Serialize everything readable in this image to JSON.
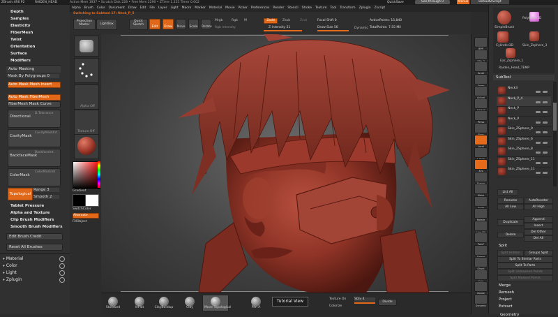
{
  "titlebar": {
    "app": "ZBrush 4R6 P2",
    "doc": "RAIDEN_HEAD",
    "stats": "Active Mem 1937 • Scratch Disk 228 • Free Mem 2290 • ZTime 1.255 Timer 0.002",
    "quicksave": "QuickSave",
    "seethrough": "See-through 0",
    "menus": "Menus",
    "script": "DefaultZScript"
  },
  "menubar": [
    "Alpha",
    "Brush",
    "Color",
    "Document",
    "Draw",
    "Edit",
    "File",
    "Layer",
    "Light",
    "Macro",
    "Marker",
    "Material",
    "Movie",
    "Picker",
    "Preferences",
    "Render",
    "Stencil",
    "Stroke",
    "Texture",
    "Tool",
    "Transform",
    "Zplugin",
    "Zscript"
  ],
  "switching": "Switching to Subtool 17: Neck_P_5",
  "shelf": {
    "projection_master": "Projection Master",
    "lightbox": "LightBox",
    "quick_sketch": "Quick Sketch",
    "edit": "Edit",
    "draw": "Draw",
    "move": "Move",
    "scale": "Scale",
    "rotate": "Rotate",
    "mrgb": "Mrgb",
    "rgb": "Rgb",
    "m": "M",
    "rgb_intensity": "Rgb Intensity",
    "zadd": "Zadd",
    "zsub": "Zsub",
    "zcut": "Zcut",
    "z_intensity": "Z Intensity 51",
    "focal_shift": "Focal Shift 0",
    "draw_size": "Draw Size 56",
    "dynamic": "Dynamic",
    "active_points": "ActivePoints: 15,840",
    "total_points": "TotalPoints: 7.55 Mil"
  },
  "left_tray": {
    "headers": [
      "Depth",
      "Samples",
      "Elasticity",
      "FiberMesh",
      "Twist",
      "Orientation",
      "Surface",
      "Modifiers"
    ],
    "auto_masking": "Auto Masking",
    "mask_by_polygroups": "Mask By Polygroups 0",
    "auto_mask_mesh_insert": "Auto Mask Mesh Insert",
    "auto_mask_fibermesh": "Auto Mask FiberMesh",
    "fibermesh_mask_curve": "FiberMesh Mask Curve",
    "directional": "Directional",
    "directional_val": "D.Tolerance",
    "cavity_mask": "CavityMask",
    "cavity_val": "CavityMaskInt",
    "backface_mask": "BackfaceMask",
    "backface_val": "BackfaceInt",
    "color_mask": "ColorMask",
    "color_val": "ColorMaskInt",
    "topological": "Topological",
    "range": "Range 3",
    "smooth": "Smooth 2",
    "sections": [
      "Tablet Pressure",
      "Alpha and Texture",
      "Clip Brush Modifiers",
      "Smooth Brush Modifiers"
    ],
    "edit_brush_credit": "Edit Brush Credit",
    "reset_all_brushes": "Reset All Brushes",
    "palettes": [
      "Material",
      "Color",
      "Light",
      "Zplugin"
    ]
  },
  "brush_col": {
    "alpha_off": "Alpha Off",
    "texture_off": "Texture Off",
    "gradient": "Gradient",
    "switch_color": "SwitchColor",
    "alternate": "Alternate",
    "fillobject": "FillObject"
  },
  "right_shelf": [
    "BPR",
    "SPix 3",
    "Scroll",
    "Zoom",
    "Actual",
    "AAHalf",
    "Persp",
    "Floor",
    "Local",
    "L.Sym",
    "Xyz",
    "Frame",
    "Move",
    "Scale",
    "Rotate",
    "Line Fill",
    "PolyF",
    "Transp",
    "Ghost",
    "Solo",
    "Xpose",
    "Dynamic"
  ],
  "right_tray": {
    "tools": [
      "SimpleBrush",
      "PolyMesh3D",
      "Cylinder3D",
      "Skin_Zsphere_3",
      "Ear_Zsphere_1",
      "Raiden_Head_TEMP"
    ],
    "subtool_header": "SubTool",
    "subtools": [
      "Neck3",
      "Neck_P_4",
      "Neck_P",
      "Neck_P",
      "Skin_ZSphere_9",
      "Skin_ZSphere_6",
      "Skin_ZSphere_8",
      "Skin_ZSphere_11",
      "Skin_ZSphere_11"
    ],
    "list_all": "List All",
    "rename": "Rename",
    "autoreorder": "AutoReorder",
    "all_low": "All Low",
    "all_high": "All High",
    "duplicate": "Duplicate",
    "append": "Append",
    "insert": "Insert",
    "delete": "Delete",
    "del_other": "Del Other",
    "del_all": "Del All",
    "split": "Split",
    "split_hidden": "Split Hidden",
    "groups_split": "Groups Split",
    "split_to_similar_parts": "Split To Similar Parts",
    "split_to_parts": "Split To Parts",
    "split_unmasked_points": "Split Unmasked Points",
    "split_masked_points": "Split Masked Points",
    "merge": "Merge",
    "remesh": "Remesh",
    "project": "Project",
    "extract": "Extract",
    "geometry": "Geometry"
  },
  "bottom_shelf": {
    "tools": [
      "Standard",
      "InFlat",
      "ClayBuildup",
      "Clay",
      "Move Topological",
      "Pen A"
    ],
    "tutorial_view": "Tutorial View",
    "texture_on": "Texture On",
    "colorize": "Colorize",
    "sdiv": "SDiv 4",
    "divide": "Divide"
  },
  "colors": {
    "accent": "#e56a1a",
    "model": "#9b3a2e",
    "panel": "#303030"
  }
}
